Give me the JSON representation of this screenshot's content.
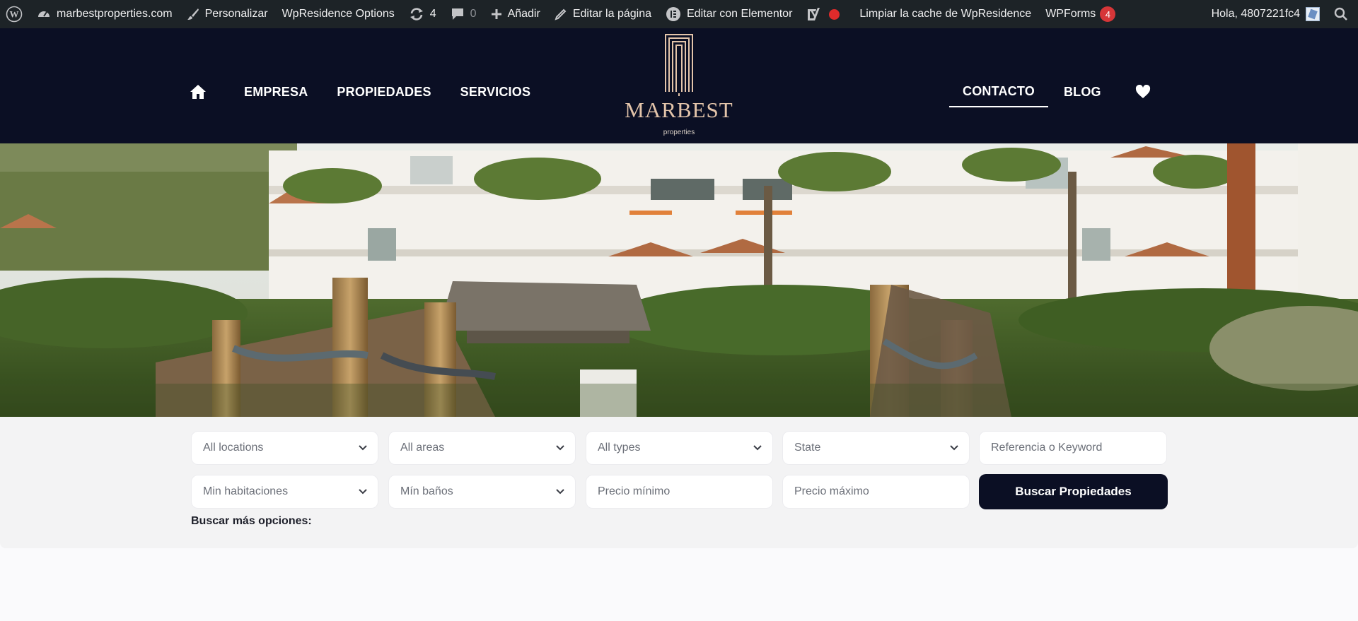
{
  "adminbar": {
    "site": "marbestproperties.com",
    "customize": "Personalizar",
    "options": "WpResidence Options",
    "updates_count": "4",
    "comments_count": "0",
    "add_new": "Añadir",
    "edit_page": "Editar la página",
    "edit_elementor": "Editar con Elementor",
    "clear_cache": "Limpiar la cache de WpResidence",
    "wpforms": "WPForms",
    "wpforms_count": "4",
    "greeting": "Hola, 4807221fc4"
  },
  "nav": {
    "left": [
      "EMPRESA",
      "PROPIEDADES",
      "SERVICIOS"
    ],
    "contact": "CONTACTO",
    "blog": "BLOG"
  },
  "logo": {
    "name": "MARBEST",
    "tagline": "properties",
    "color": "#e3c4aa"
  },
  "search": {
    "row1": {
      "locations": "All locations",
      "areas": "All areas",
      "types": "All types",
      "state": "State",
      "keyword_placeholder": "Referencia o Keyword"
    },
    "row2": {
      "rooms": "Min habitaciones",
      "baths": "Mín baños",
      "min_price_placeholder": "Precio mínimo",
      "max_price_placeholder": "Precio máximo",
      "submit": "Buscar Propiedades"
    },
    "more_options": "Buscar más opciones:"
  },
  "colors": {
    "adminbar": "#1d2327",
    "header": "#0b0f24",
    "accent": "#e3c4aa",
    "badge": "#d63638"
  }
}
